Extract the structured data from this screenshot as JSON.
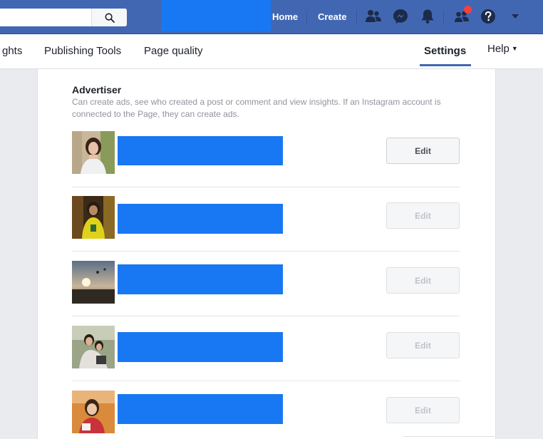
{
  "search": {
    "placeholder": "",
    "value": ""
  },
  "topnav": {
    "home": "Home",
    "create": "Create"
  },
  "tabs": {
    "insights": "ghts",
    "publishing_tools": "Publishing Tools",
    "page_quality": "Page quality",
    "settings": "Settings",
    "help": "Help"
  },
  "role": {
    "title": "Advertiser",
    "description": "Can create ads, see who created a post or comment and view insights. If an Instagram account is connected to the Page, they can create ads."
  },
  "people": [
    {
      "edit_label": "Edit",
      "enabled": true
    },
    {
      "edit_label": "Edit",
      "enabled": false
    },
    {
      "edit_label": "Edit",
      "enabled": false
    },
    {
      "edit_label": "Edit",
      "enabled": false
    },
    {
      "edit_label": "Edit",
      "enabled": false
    }
  ],
  "colors": {
    "topbar": "#4267b2",
    "redaction": "#1877f2",
    "notification": "#fa3e3e"
  },
  "icons": {
    "search": "search-icon",
    "friends": "friends-icon",
    "messenger": "messenger-icon",
    "notifications": "bell-icon",
    "friend_requests": "friend-requests-icon",
    "help": "help-icon",
    "account_menu": "caret-down-icon"
  }
}
